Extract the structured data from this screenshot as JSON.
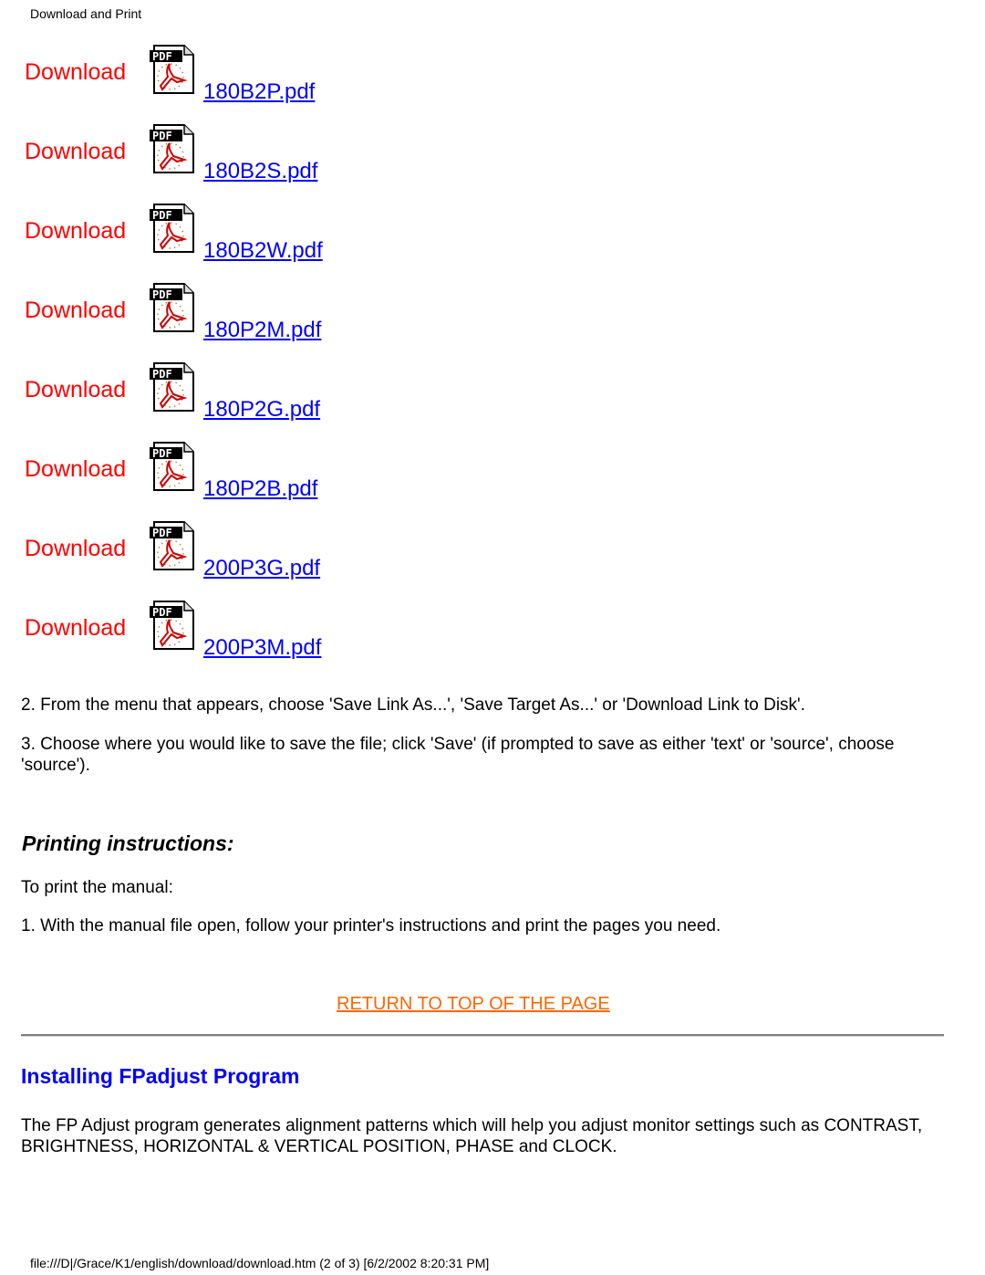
{
  "header": {
    "title": "Download and Print"
  },
  "downloads": [
    {
      "label": "Download",
      "icon": "pdf-icon",
      "file": "180B2P.pdf"
    },
    {
      "label": "Download",
      "icon": "pdf-icon",
      "file": "180B2S.pdf"
    },
    {
      "label": "Download",
      "icon": "pdf-icon",
      "file": "180B2W.pdf"
    },
    {
      "label": "Download",
      "icon": "pdf-icon",
      "file": "180P2M.pdf"
    },
    {
      "label": "Download",
      "icon": "pdf-icon",
      "file": "180P2G.pdf"
    },
    {
      "label": "Download",
      "icon": "pdf-icon",
      "file": "180P2B.pdf"
    },
    {
      "label": "Download",
      "icon": "pdf-icon",
      "file": "200P3G.pdf"
    },
    {
      "label": "Download",
      "icon": "pdf-icon",
      "file": "200P3M.pdf"
    }
  ],
  "steps": {
    "step2": "2. From the menu that appears, choose 'Save Link As...', 'Save Target As...' or 'Download Link to Disk'.",
    "step3": "3. Choose where you would like to save the file; click 'Save' (if prompted to save as either 'text' or 'source', choose 'source')."
  },
  "printing": {
    "heading": "Printing instructions:",
    "intro": "To print the manual:",
    "step1": "1. With the manual file open, follow your printer's instructions and print the pages you need."
  },
  "return_link": "RETURN TO TOP OF THE PAGE",
  "fpadjust": {
    "heading": "Installing FPadjust Program",
    "body": "The FP Adjust program generates alignment patterns which will help you adjust monitor settings such as CONTRAST, BRIGHTNESS, HORIZONTAL & VERTICAL POSITION, PHASE and CLOCK."
  },
  "footer": {
    "path": "file:///D|/Grace/K1/english/download/download.htm (2 of 3) [6/2/2002 8:20:31 PM]"
  },
  "colors": {
    "download_label": "#ff0000",
    "file_link": "#0000ff",
    "return_link": "#ff6600",
    "section_heading": "#0000ff"
  }
}
